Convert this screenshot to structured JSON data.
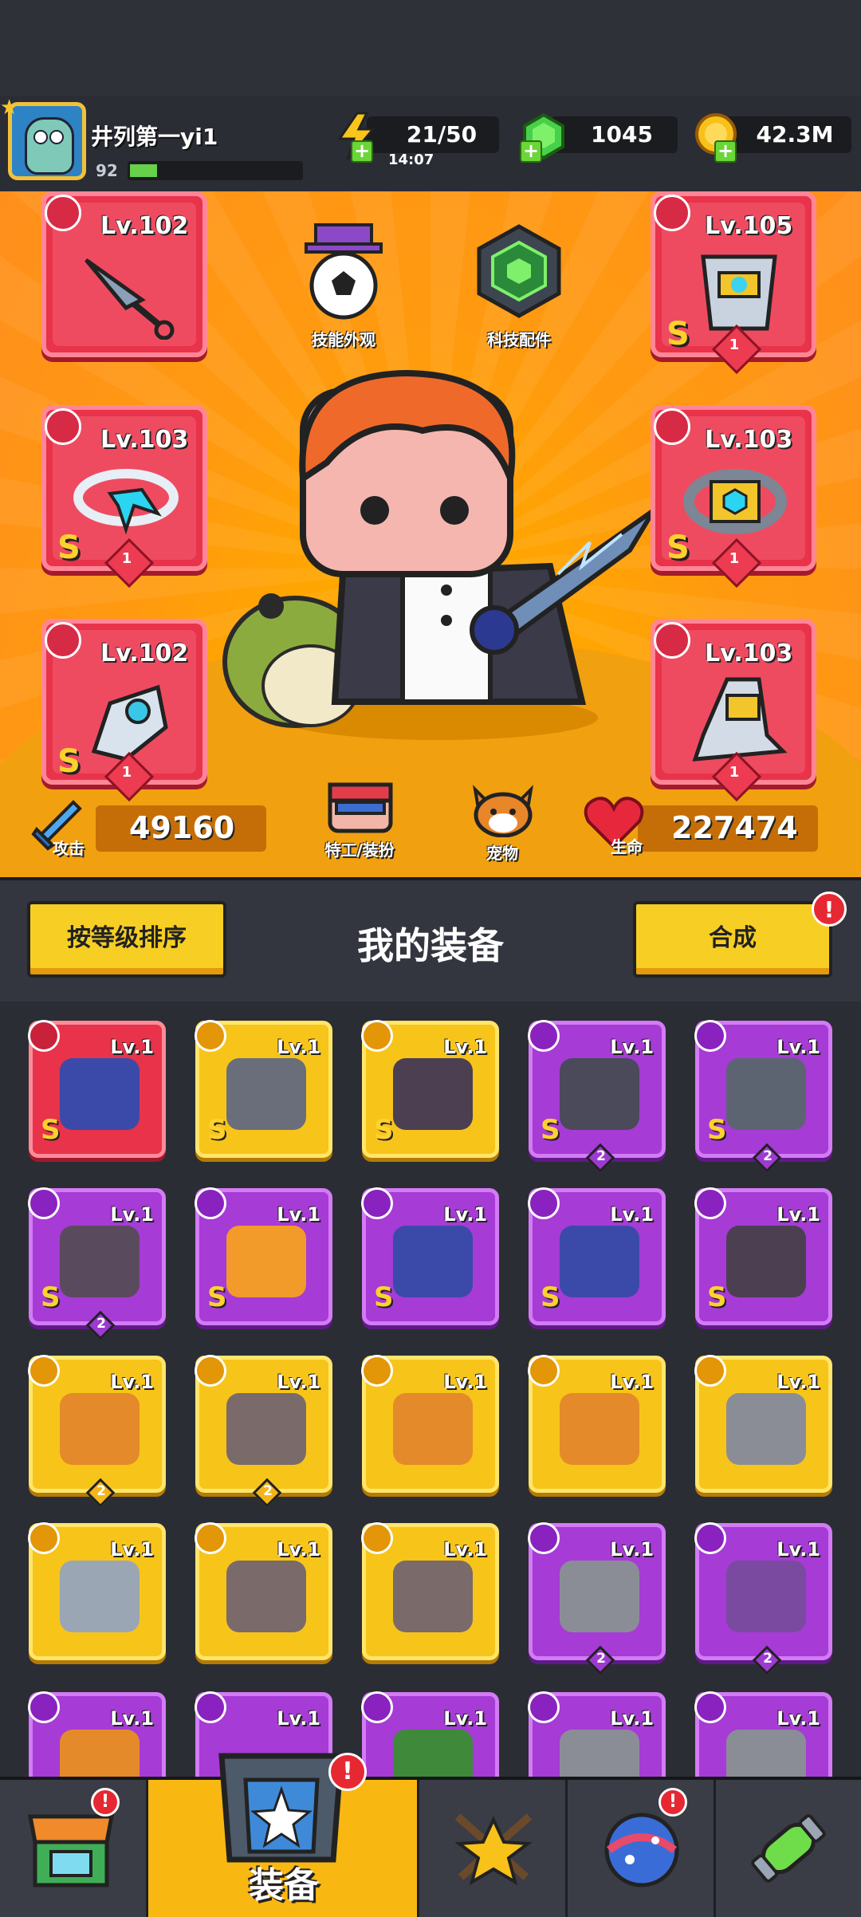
{
  "player": {
    "name": "井列第一yi1",
    "level": "92"
  },
  "resources": {
    "energy": "21/50",
    "energy_timer": "14:07",
    "gems": "1045",
    "coins": "42.3M"
  },
  "equipped": {
    "weapon": {
      "level": "Lv.102"
    },
    "armor": {
      "level": "Lv.105",
      "rarity": "S",
      "count": "1"
    },
    "necklace": {
      "level": "Lv.103",
      "rarity": "S",
      "count": "1"
    },
    "belt": {
      "level": "Lv.103",
      "rarity": "S",
      "count": "1"
    },
    "gloves": {
      "level": "Lv.102",
      "rarity": "S",
      "count": "1"
    },
    "boots": {
      "level": "Lv.103",
      "count": "1"
    }
  },
  "hero_buttons": {
    "skill_skin": "技能外观",
    "tech_parts": "科技配件",
    "agent_outfit": "特工/装扮",
    "pet": "宠物"
  },
  "stats": {
    "attack_label": "攻击",
    "attack": "49160",
    "hp_label": "生命",
    "hp": "227474"
  },
  "equipment_panel": {
    "sort_button": "按等级排序",
    "title": "我的装备",
    "merge_button": "合成",
    "merge_alert": "!"
  },
  "inventory": [
    {
      "level": "Lv.1",
      "rarity": "S",
      "count": ""
    },
    {
      "level": "Lv.1",
      "rarity": "S",
      "count": ""
    },
    {
      "level": "Lv.1",
      "rarity": "S",
      "count": ""
    },
    {
      "level": "Lv.1",
      "rarity": "S",
      "count": "2"
    },
    {
      "level": "Lv.1",
      "rarity": "S",
      "count": "2"
    },
    {
      "level": "Lv.1",
      "rarity": "S",
      "count": "2"
    },
    {
      "level": "Lv.1",
      "rarity": "S",
      "count": ""
    },
    {
      "level": "Lv.1",
      "rarity": "S",
      "count": ""
    },
    {
      "level": "Lv.1",
      "rarity": "S",
      "count": ""
    },
    {
      "level": "Lv.1",
      "rarity": "S",
      "count": ""
    },
    {
      "level": "Lv.1",
      "rarity": "",
      "count": "2"
    },
    {
      "level": "Lv.1",
      "rarity": "",
      "count": "2"
    },
    {
      "level": "Lv.1",
      "rarity": "",
      "count": ""
    },
    {
      "level": "Lv.1",
      "rarity": "",
      "count": ""
    },
    {
      "level": "Lv.1",
      "rarity": "",
      "count": ""
    },
    {
      "level": "Lv.1",
      "rarity": "",
      "count": ""
    },
    {
      "level": "Lv.1",
      "rarity": "",
      "count": ""
    },
    {
      "level": "Lv.1",
      "rarity": "",
      "count": ""
    },
    {
      "level": "Lv.1",
      "rarity": "",
      "count": "2"
    },
    {
      "level": "Lv.1",
      "rarity": "",
      "count": "2"
    },
    {
      "level": "Lv.1",
      "rarity": "",
      "count": ""
    },
    {
      "level": "Lv.1",
      "rarity": "",
      "count": ""
    },
    {
      "level": "Lv.1",
      "rarity": "",
      "count": ""
    },
    {
      "level": "Lv.1",
      "rarity": "",
      "count": ""
    },
    {
      "level": "Lv.1",
      "rarity": "",
      "count": ""
    }
  ],
  "nav": {
    "equipment_label": "装备",
    "alert": "!"
  },
  "colors": {
    "red_rarity": "#e8334a",
    "yellow_rarity": "#f7c41a",
    "purple_rarity": "#a63bd6",
    "accent": "#f7cf24"
  }
}
